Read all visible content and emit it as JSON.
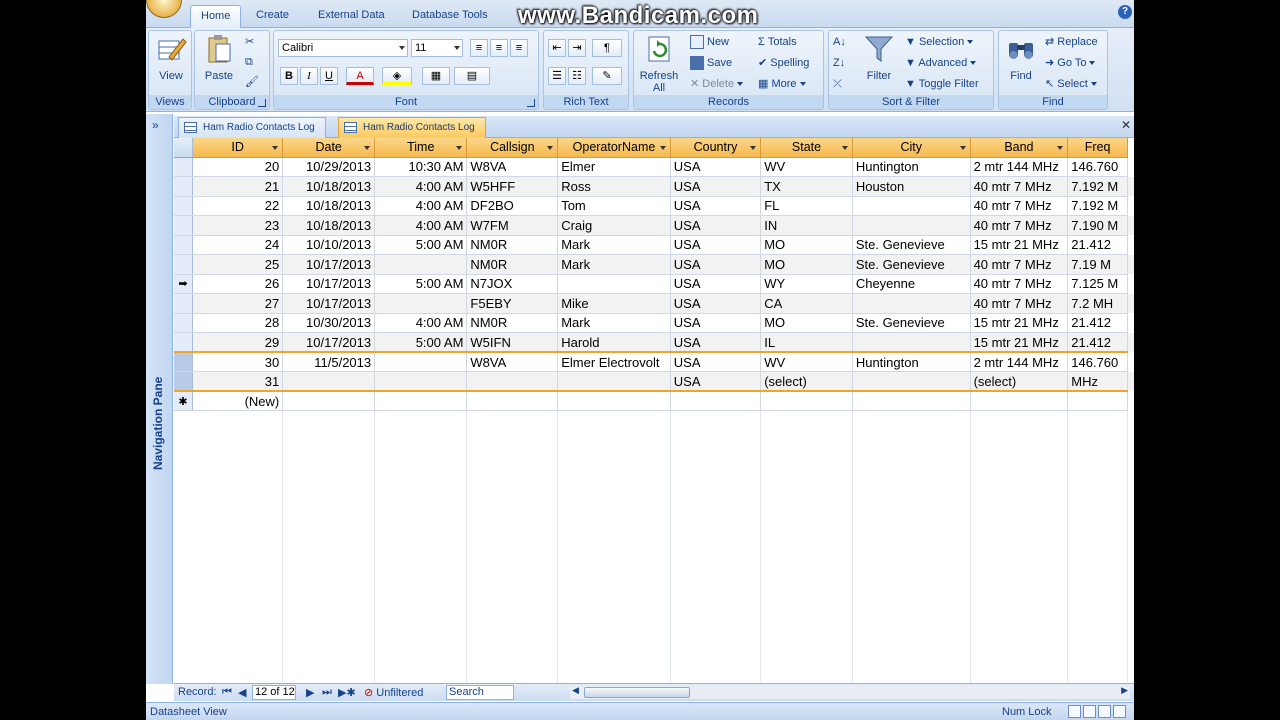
{
  "watermark": "www.Bandicam.com",
  "ribbon_tabs": [
    "Home",
    "Create",
    "External Data",
    "Database Tools"
  ],
  "groups": {
    "views": {
      "label": "Views",
      "view_btn": "View"
    },
    "clipboard": {
      "label": "Clipboard",
      "paste_btn": "Paste"
    },
    "font": {
      "label": "Font",
      "font_name": "Calibri",
      "font_size": "11",
      "bold": "B",
      "italic": "I",
      "underline": "U"
    },
    "rich_text": {
      "label": "Rich Text"
    },
    "records": {
      "label": "Records",
      "refresh": "Refresh All",
      "new": "New",
      "save": "Save",
      "delete": "Delete",
      "totals": "Totals",
      "spelling": "Spelling",
      "more": "More"
    },
    "sort_filter": {
      "label": "Sort & Filter",
      "filter": "Filter",
      "selection": "Selection",
      "advanced": "Advanced",
      "toggle_filter": "Toggle Filter"
    },
    "find": {
      "label": "Find",
      "find": "Find",
      "replace": "Replace",
      "goto": "Go To",
      "select": "Select"
    }
  },
  "nav_pane": {
    "label": "Navigation Pane",
    "toggle": "»"
  },
  "doc_tabs": [
    {
      "label": "Ham Radio Contacts Log",
      "active": false
    },
    {
      "label": "Ham Radio Contacts Log",
      "active": true
    }
  ],
  "table": {
    "columns": [
      "ID",
      "Date",
      "Time",
      "Callsign",
      "OperatorName",
      "Country",
      "State",
      "City",
      "Band",
      "Freq"
    ],
    "rows": [
      [
        "20",
        "10/29/2013",
        "10:30 AM",
        "W8VA",
        "Elmer",
        "USA",
        "WV",
        "Huntington",
        "2 mtr  144 MHz",
        "146.760"
      ],
      [
        "21",
        "10/18/2013",
        "4:00 AM",
        "W5HFF",
        "Ross",
        "USA",
        "TX",
        "Houston",
        "40 mtr  7 MHz",
        "7.192    M"
      ],
      [
        "22",
        "10/18/2013",
        "4:00 AM",
        "DF2BO",
        "Tom",
        "USA",
        "FL",
        "",
        "40 mtr  7 MHz",
        "7.192    M"
      ],
      [
        "23",
        "10/18/2013",
        "4:00 AM",
        "W7FM",
        "Craig",
        "USA",
        "IN",
        "",
        "40 mtr  7 MHz",
        "7.190    M"
      ],
      [
        "24",
        "10/10/2013",
        "5:00 AM",
        "NM0R",
        "Mark",
        "USA",
        "MO",
        "Ste. Genevieve",
        "15 mtr  21 MHz",
        "21.412    "
      ],
      [
        "25",
        "10/17/2013",
        "",
        "NM0R",
        "Mark",
        "USA",
        "MO",
        "Ste. Genevieve",
        "40 mtr  7 MHz",
        "7.19    M"
      ],
      [
        "26",
        "10/17/2013",
        "5:00 AM",
        "N7JOX",
        "",
        "USA",
        "WY",
        "Cheyenne",
        "40 mtr  7 MHz",
        "7.125    M"
      ],
      [
        "27",
        "10/17/2013",
        "",
        "F5EBY",
        "Mike",
        "USA",
        "CA",
        "",
        "40 mtr  7 MHz",
        "7.2    MH"
      ],
      [
        "28",
        "10/30/2013",
        "4:00 AM",
        "NM0R",
        "Mark",
        "USA",
        "MO",
        "Ste. Genevieve",
        "15 mtr  21 MHz",
        "21.412"
      ],
      [
        "29",
        "10/17/2013",
        "5:00 AM",
        "W5IFN",
        "Harold",
        "USA",
        "IL",
        "",
        "15 mtr  21 MHz",
        "21.412"
      ],
      [
        "30",
        "11/5/2013",
        "",
        "W8VA",
        "Elmer Electrovolt",
        "USA",
        "WV",
        "Huntington",
        "2 mtr  144 MHz",
        "146.760"
      ],
      [
        "31",
        "",
        "",
        "",
        "",
        "USA",
        "(select)",
        "",
        "(select)",
        "MHz"
      ]
    ],
    "new_row_label": "(New)",
    "current_row_marker": "➡",
    "new_row_marker": "✱"
  },
  "record_nav": {
    "label": "Record:",
    "position": "12 of 12",
    "filter_status": "Unfiltered",
    "search_placeholder": "Search"
  },
  "status": {
    "left": "Datasheet View",
    "right": "Num Lock"
  }
}
